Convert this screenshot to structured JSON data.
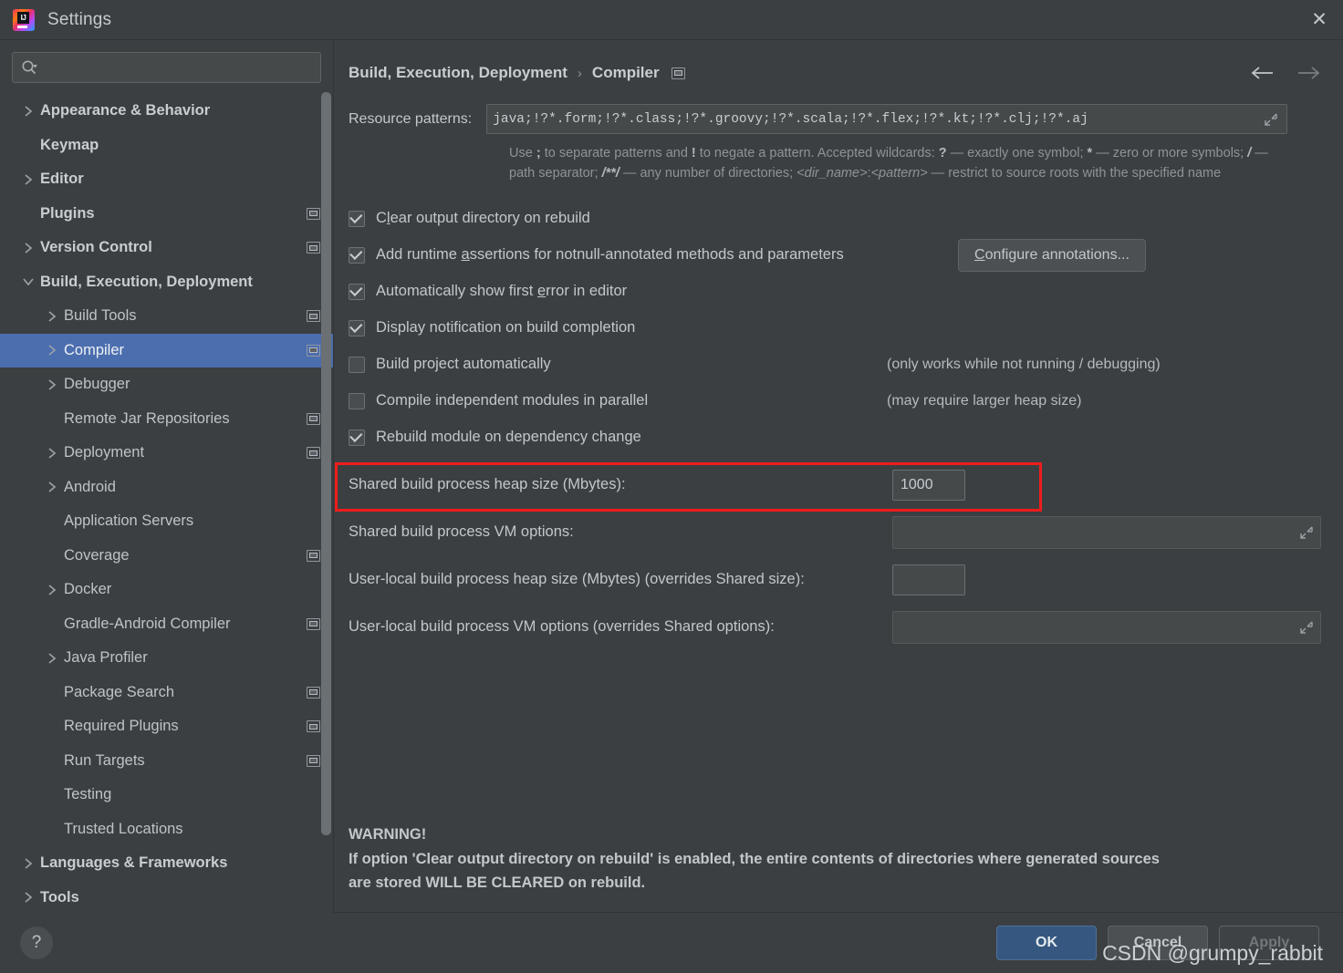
{
  "window": {
    "title": "Settings",
    "logo_text": "IJ",
    "close_label": "✕"
  },
  "sidebar": {
    "search": {
      "value": "",
      "placeholder": ""
    },
    "items": [
      {
        "label": "Appearance & Behavior",
        "level": 0,
        "expandable": true,
        "expanded": false,
        "project": false,
        "selected": false
      },
      {
        "label": "Keymap",
        "level": 0,
        "expandable": false,
        "expanded": false,
        "project": false,
        "selected": false
      },
      {
        "label": "Editor",
        "level": 0,
        "expandable": true,
        "expanded": false,
        "project": false,
        "selected": false
      },
      {
        "label": "Plugins",
        "level": 0,
        "expandable": false,
        "expanded": false,
        "project": true,
        "selected": false
      },
      {
        "label": "Version Control",
        "level": 0,
        "expandable": true,
        "expanded": false,
        "project": true,
        "selected": false
      },
      {
        "label": "Build, Execution, Deployment",
        "level": 0,
        "expandable": true,
        "expanded": true,
        "project": false,
        "selected": false
      },
      {
        "label": "Build Tools",
        "level": 1,
        "expandable": true,
        "expanded": false,
        "project": true,
        "selected": false
      },
      {
        "label": "Compiler",
        "level": 1,
        "expandable": true,
        "expanded": false,
        "project": true,
        "selected": true
      },
      {
        "label": "Debugger",
        "level": 1,
        "expandable": true,
        "expanded": false,
        "project": false,
        "selected": false
      },
      {
        "label": "Remote Jar Repositories",
        "level": 1,
        "expandable": false,
        "expanded": false,
        "project": true,
        "selected": false
      },
      {
        "label": "Deployment",
        "level": 1,
        "expandable": true,
        "expanded": false,
        "project": true,
        "selected": false
      },
      {
        "label": "Android",
        "level": 1,
        "expandable": true,
        "expanded": false,
        "project": false,
        "selected": false
      },
      {
        "label": "Application Servers",
        "level": 1,
        "expandable": false,
        "expanded": false,
        "project": false,
        "selected": false
      },
      {
        "label": "Coverage",
        "level": 1,
        "expandable": false,
        "expanded": false,
        "project": true,
        "selected": false
      },
      {
        "label": "Docker",
        "level": 1,
        "expandable": true,
        "expanded": false,
        "project": false,
        "selected": false
      },
      {
        "label": "Gradle-Android Compiler",
        "level": 1,
        "expandable": false,
        "expanded": false,
        "project": true,
        "selected": false
      },
      {
        "label": "Java Profiler",
        "level": 1,
        "expandable": true,
        "expanded": false,
        "project": false,
        "selected": false
      },
      {
        "label": "Package Search",
        "level": 1,
        "expandable": false,
        "expanded": false,
        "project": true,
        "selected": false
      },
      {
        "label": "Required Plugins",
        "level": 1,
        "expandable": false,
        "expanded": false,
        "project": true,
        "selected": false
      },
      {
        "label": "Run Targets",
        "level": 1,
        "expandable": false,
        "expanded": false,
        "project": true,
        "selected": false
      },
      {
        "label": "Testing",
        "level": 1,
        "expandable": false,
        "expanded": false,
        "project": false,
        "selected": false
      },
      {
        "label": "Trusted Locations",
        "level": 1,
        "expandable": false,
        "expanded": false,
        "project": false,
        "selected": false
      },
      {
        "label": "Languages & Frameworks",
        "level": 0,
        "expandable": true,
        "expanded": false,
        "project": false,
        "selected": false
      },
      {
        "label": "Tools",
        "level": 0,
        "expandable": true,
        "expanded": false,
        "project": false,
        "selected": false
      }
    ]
  },
  "breadcrumb": {
    "parent": "Build, Execution, Deployment",
    "separator": "›",
    "current": "Compiler",
    "back_title": "Back",
    "forward_title": "Forward"
  },
  "resource_patterns": {
    "label": "Resource patterns:",
    "value": "java;!?*.form;!?*.class;!?*.groovy;!?*.scala;!?*.flex;!?*.kt;!?*.clj;!?*.aj",
    "hint_line1_a": "Use ",
    "hint_semicolon": ";",
    "hint_line1_b": " to separate patterns and ",
    "hint_bang": "!",
    "hint_line1_c": " to negate a pattern. Accepted wildcards: ",
    "hint_q": "?",
    "hint_line1_d": " — exactly one symbol; ",
    "hint_star": "*",
    "hint_line1_e": " — zero or more symbols; ",
    "hint_slash": "/",
    "hint_line2_a": " — path separator; ",
    "hint_globstar": "/**/",
    "hint_line2_b": " — any number of directories;  ",
    "hint_dirname": "<dir_name>",
    "hint_colon": ":",
    "hint_pattern": "<pattern>",
    "hint_line2_c": " — restrict to source roots with the specified name"
  },
  "checkboxes": [
    {
      "label_pre": "C",
      "mnemonic": "l",
      "label_post": "ear output directory on rebuild",
      "checked": true,
      "note": "",
      "button": ""
    },
    {
      "label_pre": "Add runtime ",
      "mnemonic": "a",
      "label_post": "ssertions for notnull-annotated methods and parameters",
      "checked": true,
      "note": "",
      "button": "Configure annotations..."
    },
    {
      "label_pre": "Automatically show first ",
      "mnemonic": "e",
      "label_post": "rror in editor",
      "checked": true,
      "note": "",
      "button": ""
    },
    {
      "label_pre": "Display notification on build completion",
      "mnemonic": "",
      "label_post": "",
      "checked": true,
      "note": "",
      "button": ""
    },
    {
      "label_pre": "Build project automatically",
      "mnemonic": "",
      "label_post": "",
      "checked": false,
      "note": "(only works while not running / debugging)",
      "button": ""
    },
    {
      "label_pre": "Compile independent modules in parallel",
      "mnemonic": "",
      "label_post": "",
      "checked": false,
      "note": "(may require larger heap size)",
      "button": ""
    },
    {
      "label_pre": "Rebuild module on dependency change",
      "mnemonic": "",
      "label_post": "",
      "checked": true,
      "note": "",
      "button": ""
    }
  ],
  "configure_button": {
    "mnemonic": "C",
    "rest": "onfigure annotations..."
  },
  "fields": [
    {
      "label": "Shared build process heap size (Mbytes):",
      "type": "number",
      "value": "1000",
      "highlighted": true
    },
    {
      "label": "Shared build process VM options:",
      "type": "text-expand",
      "value": "",
      "highlighted": false
    },
    {
      "label": "User-local build process heap size (Mbytes) (overrides Shared size):",
      "type": "number",
      "value": "",
      "highlighted": false
    },
    {
      "label": "User-local build process VM options (overrides Shared options):",
      "type": "text-expand",
      "value": "",
      "highlighted": false
    }
  ],
  "warning": {
    "title": "WARNING!",
    "line1": "If option 'Clear output directory on rebuild' is enabled, the entire contents of directories where generated sources",
    "line2": "are stored WILL BE CLEARED on rebuild."
  },
  "footer": {
    "help_label": "?",
    "ok": "OK",
    "cancel": "Cancel",
    "apply": "Apply"
  },
  "watermark": "CSDN @grumpy_rabbit",
  "colors": {
    "accent": "#4b6eaf",
    "primary_button": "#365880",
    "highlight_border": "#ef1c1c",
    "background": "#3c3f41"
  }
}
